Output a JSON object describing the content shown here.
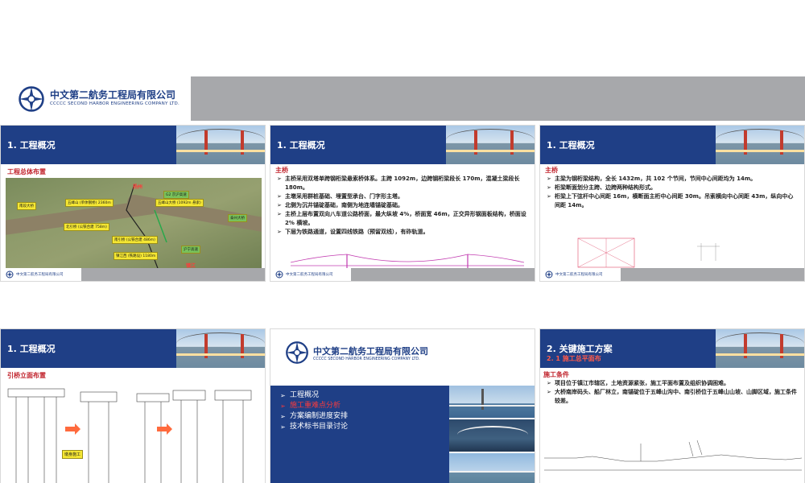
{
  "banner": {
    "company_cn": "中文第二航务工程局有限公司",
    "company_en": "CCCCC SECOND HARBOR ENGINEERING COMPANY LTD."
  },
  "footer_company": "中文第二航务工程局有限公司",
  "slides": [
    {
      "title": "1. 工程概况",
      "subtitle": "工程总体布置",
      "map_labels": [
        "G2 京沪高速",
        "南段大桥",
        "五峰山 (单体钢桥) 2360m",
        "五峰山大桥 (1092m 悬索)",
        "北引桥 (公铁合建 758m)",
        "南引桥 (公铁合建 486m)",
        "镇江西 (铁路设) 1180m",
        "沪宁高速",
        "泰州大桥"
      ],
      "map_red": [
        "扬州",
        "镇江"
      ]
    },
    {
      "title": "1. 工程概况",
      "subtitle": "主桥",
      "bullets": [
        "主桥采用双塔单跨钢桁梁悬索桥体系。主跨 1092m，边跨钢桁梁段长 170m，混凝土梁段长 180m。",
        "主墩采用群桩基础、埋置型承台、门字形主塔。",
        "北侧为沉井锚碇基础，南侧为地连墙锚碇基础。",
        "主桥上层布置双向八车道公路桥面，最大纵坡 4%，桥面宽 46m，正交异形钢面板结构，桥面设 2% 横坡。",
        "下层为铁路通道，设置四线铁路（预留双线），有砟轨道。"
      ]
    },
    {
      "title": "1. 工程概况",
      "subtitle": "主桥",
      "bullets": [
        "主梁为钢桁梁结构，全长 1432m，共 102 个节间，节间中心间距均为 14m。",
        "桁梁断面划分主跨、边跨两种结构形式。",
        "桁梁上下弦杆中心间距 16m，横断面主桁中心间距 30m。吊索横向中心间距 43m，纵向中心间距 14m。"
      ]
    },
    {
      "title": "1. 工程概况",
      "subtitle": "引桥立面布置",
      "callout": "墩身施工"
    },
    {
      "menu": [
        "工程概况",
        "施工重难点分析",
        "方案编制进度安排",
        "技术标书目录讨论"
      ]
    },
    {
      "title": "2. 关键施工方案",
      "section": "2. 1 施工总平面布",
      "subtitle": "施工条件",
      "bullets": [
        "项目位于镇江市辖区，土地资源紧张，施工平面布置及组织协调困难。",
        "大桥南岸码头、船厂林立，南锚碇位于五峰山沟中、南引桥位于五峰山山坡、山脚区域，施工条件较差。"
      ]
    }
  ],
  "colors": {
    "brand_blue": "#1f3f86",
    "accent_red": "#c0222b",
    "band_gray": "#a7a8ab"
  }
}
